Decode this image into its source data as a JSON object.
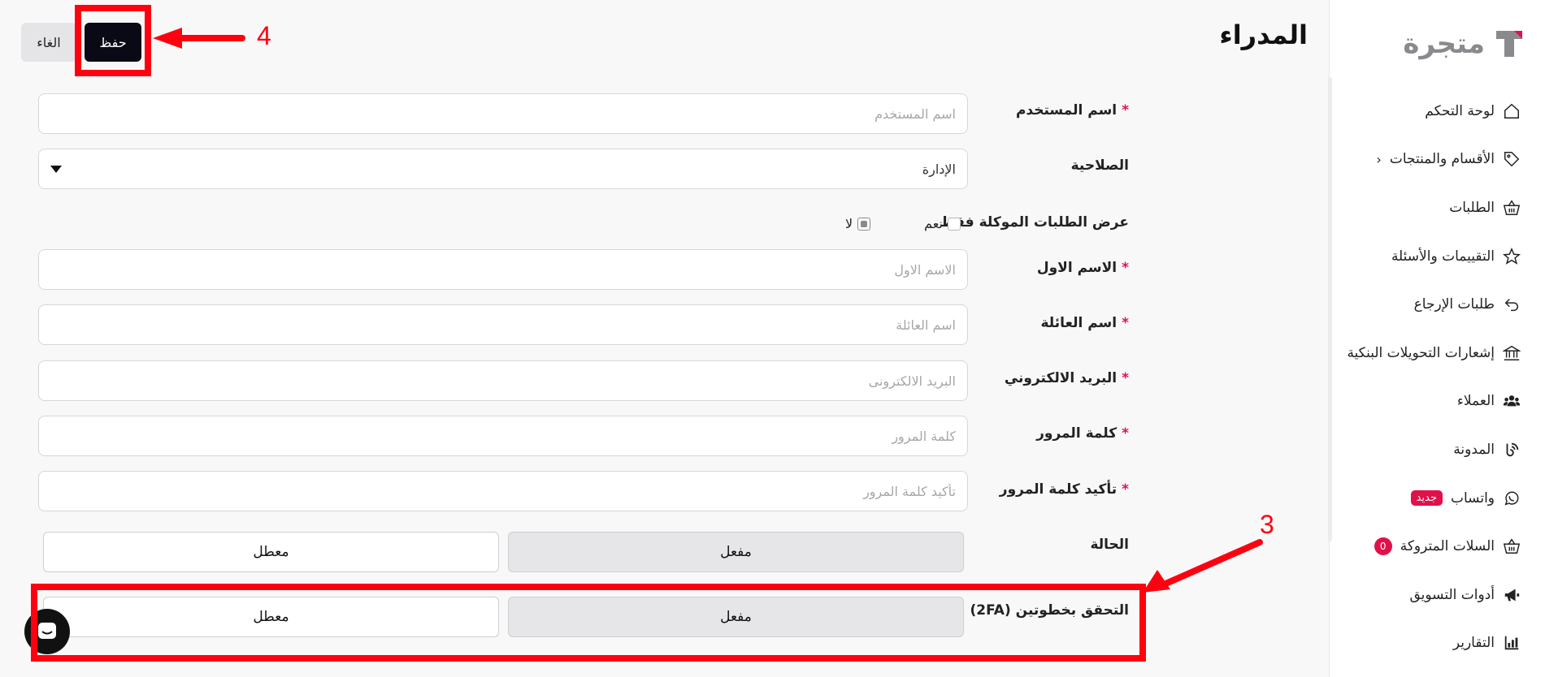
{
  "brand": {
    "name": "متجرة"
  },
  "sidebar": {
    "items": [
      {
        "label": "لوحة التحكم",
        "icon": "home-icon"
      },
      {
        "label": "الأقسام والمنتجات",
        "icon": "tag-icon"
      },
      {
        "label": "الطلبات",
        "icon": "basket-icon"
      },
      {
        "label": "التقييمات والأسئلة",
        "icon": "star-icon"
      },
      {
        "label": "طلبات الإرجاع",
        "icon": "return-icon"
      },
      {
        "label": "إشعارات التحويلات البنكية",
        "icon": "bank-icon"
      },
      {
        "label": "العملاء",
        "icon": "users-icon"
      },
      {
        "label": "المدونة",
        "icon": "blog-icon"
      },
      {
        "label": "واتساب",
        "icon": "whatsapp-icon",
        "badge": "جديد"
      },
      {
        "label": "السلات المتروكة",
        "icon": "basket-icon",
        "count": "0"
      },
      {
        "label": "أدوات التسويق",
        "icon": "megaphone-icon"
      },
      {
        "label": "التقارير",
        "icon": "chart-icon"
      }
    ]
  },
  "header": {
    "title": "المدراء",
    "save_label": "حفظ",
    "cancel_label": "الغاء"
  },
  "form": {
    "username": {
      "label": "اسم المستخدم",
      "placeholder": "اسم المستخدم"
    },
    "role": {
      "label": "الصلاحية",
      "value": "الإدارة"
    },
    "assigned_only": {
      "label": "عرض الطلبات الموكلة فقط",
      "yes": "نعم",
      "no": "لا",
      "selected": "no"
    },
    "first_name": {
      "label": "الاسم الاول",
      "placeholder": "الاسم الاول"
    },
    "last_name": {
      "label": "اسم العائلة",
      "placeholder": "اسم العائلة"
    },
    "email": {
      "label": "البريد الالكتروني",
      "placeholder": "البريد الالكترونى"
    },
    "password": {
      "label": "كلمة المرور",
      "placeholder": "كلمة المرور"
    },
    "password_confirm": {
      "label": "تأكيد كلمة المرور",
      "placeholder": "تأكيد كلمة المرور"
    },
    "status": {
      "label": "الحالة",
      "enabled": "مفعل",
      "disabled": "معطل",
      "selected": "enabled"
    },
    "two_fa": {
      "label": "التحقق بخطوتين (2FA)",
      "enabled": "مفعل",
      "disabled": "معطل",
      "selected": "enabled"
    }
  },
  "annotations": {
    "step_save": "4",
    "step_2fa": "3",
    "color": "#ff0010"
  },
  "colors": {
    "accent": "#0a0a16",
    "required": "#e0114a",
    "brand_gray": "#8a8a8e"
  }
}
